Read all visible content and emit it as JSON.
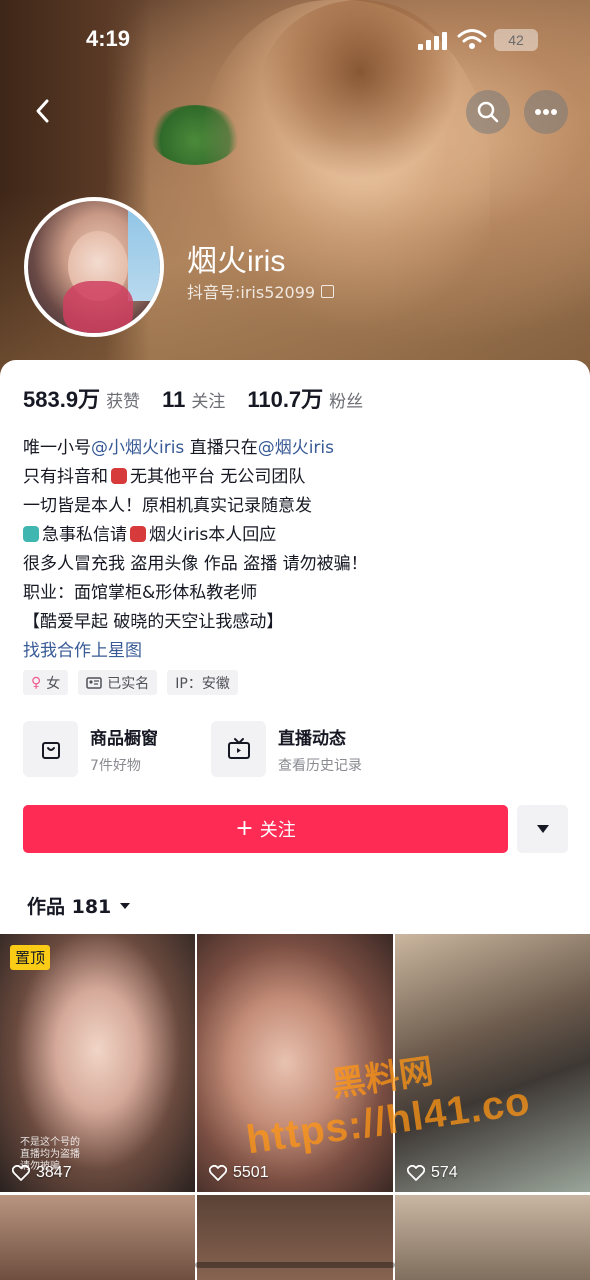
{
  "status_bar": {
    "time": "4:19",
    "battery": "42"
  },
  "profile": {
    "name": "烟火iris",
    "douyin_id": "抖音号:iris52099"
  },
  "stats": [
    {
      "value": "583.9万",
      "label": "获赞"
    },
    {
      "value": "11",
      "label": "关注"
    },
    {
      "value": "110.7万",
      "label": "粉丝"
    }
  ],
  "bio": {
    "line1_prefix": "唯一小号",
    "line1_mention1": "@小烟火iris",
    "line1_mid": " 直播只在",
    "line1_mention2": "@烟火iris",
    "line2_a": "只有抖音和",
    "line2_b": "无其他平台 无公司团队",
    "line3": "一切皆是本人！原相机真实记录随意发",
    "line4_a": "急事私信请",
    "line4_b": "烟火iris本人回应",
    "line5": "很多人冒充我 盗用头像 作品 盗播 请勿被骗！",
    "line6": "职业：面馆掌柜&形体私教老师",
    "line7": "【酷爱早起 破晓的天空让我感动】",
    "link": "找我合作上星图"
  },
  "tags": [
    "女",
    "已实名",
    "IP：安徽"
  ],
  "features": [
    {
      "title": "商品橱窗",
      "subtitle": "7件好物",
      "icon": "shopping-bag-icon"
    },
    {
      "title": "直播动态",
      "subtitle": "查看历史记录",
      "icon": "tv-icon"
    }
  ],
  "follow_label": "关注",
  "works_tab": "作品 181",
  "grid": [
    {
      "pinned": "置顶",
      "likes": "3847",
      "caption": "不是这个号的\n直播均为盗播\n请勿被骗"
    },
    {
      "likes": "5501"
    },
    {
      "likes": "574"
    }
  ],
  "watermark": {
    "title": "黑料网",
    "url": "https://hl41.co"
  },
  "colors": {
    "accent": "#fe2c55",
    "mention": "#385a96",
    "pin_badge": "#facc15"
  }
}
